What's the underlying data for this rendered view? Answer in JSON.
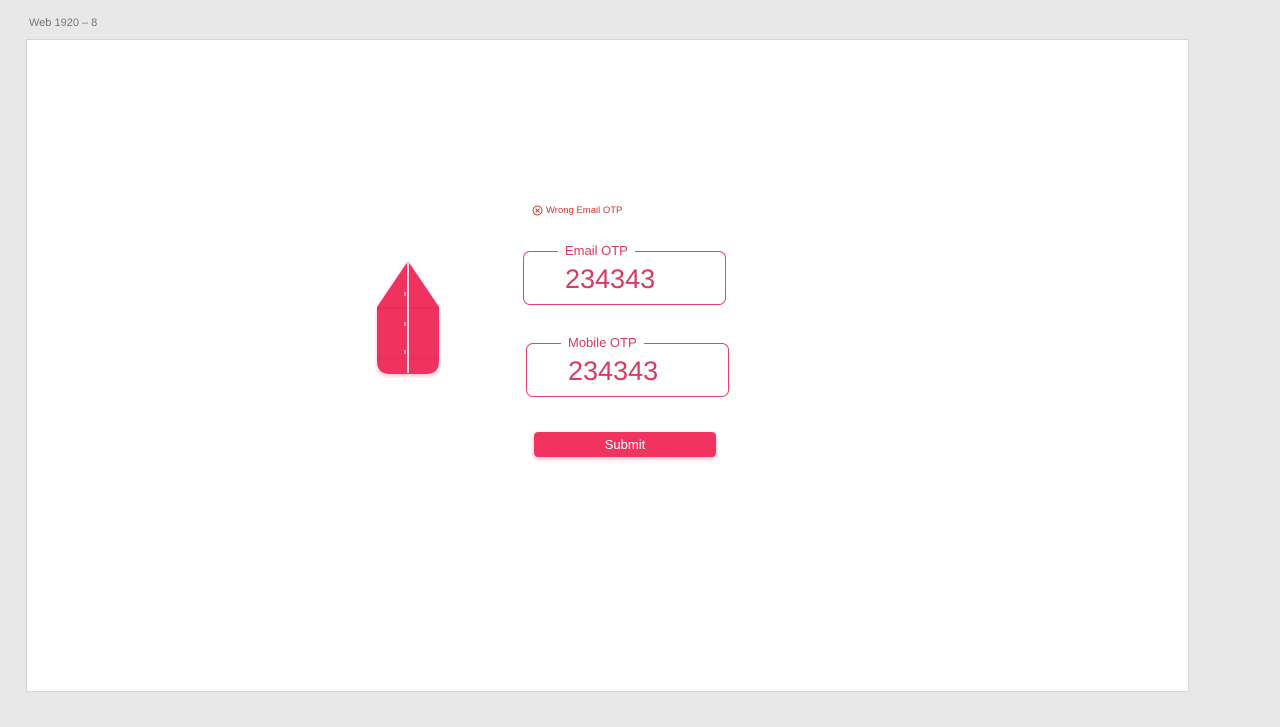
{
  "artboard": {
    "label": "Web 1920 – 8"
  },
  "brand": {
    "logo_icon": "pencil-logo-icon",
    "accent_color": "#f0335f"
  },
  "form": {
    "error": {
      "icon": "error-circle-x-icon",
      "message": "Wrong Email OTP",
      "color": "#e03131"
    },
    "email_otp": {
      "label": "Email OTP",
      "value": "234343"
    },
    "mobile_otp": {
      "label": "Mobile OTP",
      "value": "234343"
    },
    "submit_label": "Submit"
  }
}
